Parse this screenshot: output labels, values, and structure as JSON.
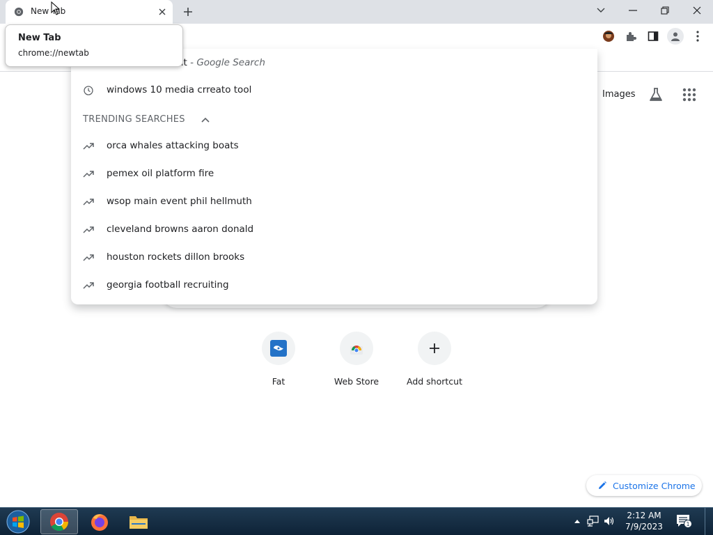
{
  "tab": {
    "title": "New Tab",
    "close_icon": "close-icon"
  },
  "tooltip": {
    "title": "New Tab",
    "url": "chrome://newtab"
  },
  "window_controls": [
    "tab-search-icon",
    "minimize-icon",
    "restore-icon",
    "close-icon"
  ],
  "toolbar": {
    "icons": [
      "avatar-extension-icon",
      "puzzle-extensions-icon",
      "side-panel-icon",
      "profile-icon",
      "kebab-menu-icon"
    ]
  },
  "ntp_header": {
    "images_label": "Images",
    "labs_icon": "flask-icon",
    "apps_icon": "apps-grid-icon"
  },
  "omnibox_dropdown": {
    "partial_row": {
      "text_visible": "ut",
      "suffix": " - Google Search"
    },
    "history_rows": [
      {
        "text": "windows 10 media crreato tool",
        "icon": "clock-icon"
      }
    ],
    "trending_header": "TRENDING SEARCHES",
    "trending": [
      "orca whales attacking boats",
      "pemex oil platform fire",
      "wsop main event phil hellmuth",
      "cleveland browns aaron donald",
      "houston rockets dillon brooks",
      "georgia football recruiting"
    ]
  },
  "shortcuts": [
    {
      "label": "Fat",
      "icon": "fatsecret-icon"
    },
    {
      "label": "Web Store",
      "icon": "chrome-web-store-icon"
    },
    {
      "label": "Add shortcut",
      "icon": "plus-icon"
    }
  ],
  "customize": {
    "label": "Customize Chrome",
    "icon": "pencil-icon"
  },
  "taskbar": {
    "apps": [
      "chrome-icon",
      "firefox-icon",
      "file-explorer-icon"
    ],
    "clock_time": "2:12 AM",
    "clock_date": "7/9/2023",
    "notification_count": "1"
  },
  "colors": {
    "accent": "#1a73e8",
    "tabstrip": "#dee1e6",
    "taskbar": "#1a3349"
  }
}
